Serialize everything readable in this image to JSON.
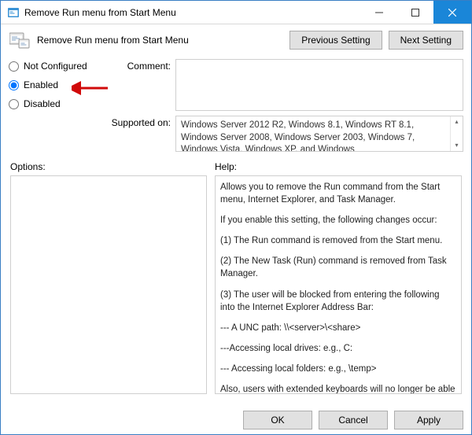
{
  "window": {
    "title": "Remove Run menu from Start Menu"
  },
  "header": {
    "policy_title": "Remove Run menu from Start Menu",
    "previous_setting": "Previous Setting",
    "next_setting": "Next Setting"
  },
  "state": {
    "not_configured": "Not Configured",
    "enabled": "Enabled",
    "disabled": "Disabled",
    "selected": "enabled",
    "comment_label": "Comment:",
    "comment_value": "",
    "supported_label": "Supported on:",
    "supported_text": "Windows Server 2012 R2, Windows 8.1, Windows RT 8.1, Windows Server 2008, Windows Server 2003, Windows 7, Windows Vista, Windows XP, and Windows"
  },
  "sections": {
    "options_label": "Options:",
    "help_label": "Help:"
  },
  "help": {
    "p1": "Allows you to remove the Run command from the Start menu, Internet Explorer, and Task Manager.",
    "p2": "If you enable this setting, the following changes occur:",
    "p3": "(1) The Run command is removed from the Start menu.",
    "p4": "(2) The New Task (Run) command is removed from Task Manager.",
    "p5": "(3) The user will be blocked from entering the following into the Internet Explorer Address Bar:",
    "p6": "--- A UNC path: \\\\<server>\\<share>",
    "p7": "---Accessing local drives:  e.g., C:",
    "p8": "--- Accessing local folders: e.g., \\temp>",
    "p9": "Also, users with extended keyboards will no longer be able to display the Run dialog box by pressing the Application key (the"
  },
  "footer": {
    "ok": "OK",
    "cancel": "Cancel",
    "apply": "Apply"
  }
}
